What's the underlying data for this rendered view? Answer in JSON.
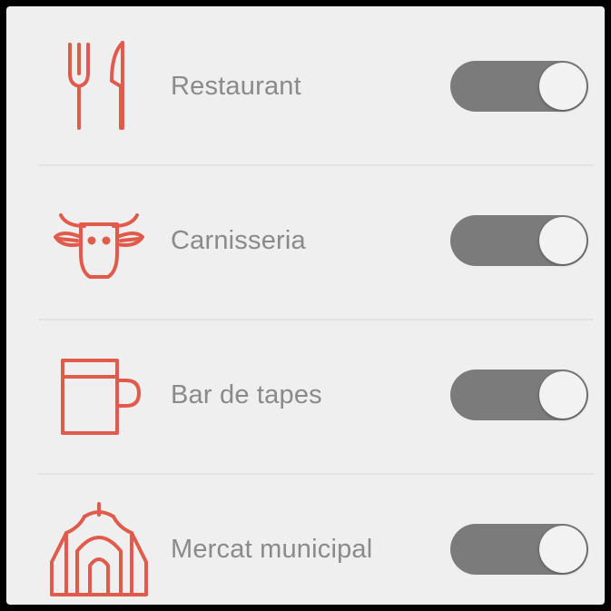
{
  "colors": {
    "icon_accent": "#e05b4b",
    "label_text": "#8a8a8a",
    "toggle_track": "#7b7b7b",
    "toggle_knob": "#f2f2f2",
    "background": "#efefef"
  },
  "settings": {
    "items": [
      {
        "label": "Restaurant",
        "icon": "fork-knife-icon",
        "enabled": true
      },
      {
        "label": "Carnisseria",
        "icon": "bull-head-icon",
        "enabled": true
      },
      {
        "label": "Bar de tapes",
        "icon": "mug-icon",
        "enabled": true
      },
      {
        "label": "Mercat municipal",
        "icon": "market-building-icon",
        "enabled": true
      }
    ]
  }
}
